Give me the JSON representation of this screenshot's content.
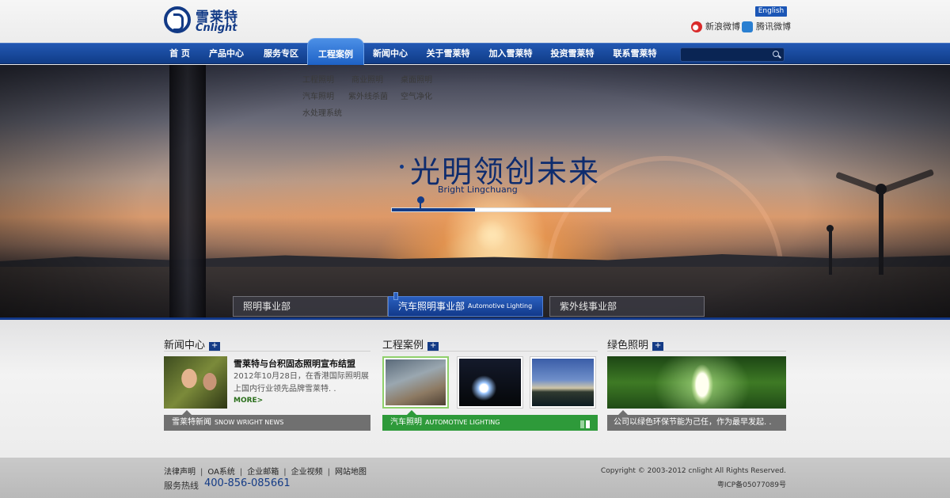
{
  "header": {
    "logo_cn": "雪莱特",
    "logo_en": "Cnlight",
    "language_button": "English",
    "weibo_sina": "新浪微博",
    "weibo_tencent": "腾讯微博"
  },
  "nav": {
    "items": [
      "首 页",
      "产品中心",
      "服务专区",
      "工程案例",
      "新闻中心",
      "关于雪莱特",
      "加入雪莱特",
      "投资雪莱特",
      "联系雪莱特"
    ],
    "active_index": 3,
    "search_placeholder": ""
  },
  "submenu": {
    "items": [
      "工程照明",
      "商业照明",
      "桌面照明",
      "汽车照明",
      "紫外线杀菌",
      "空气净化",
      "水处理系统"
    ]
  },
  "hero": {
    "slogan": "光明领创未来",
    "slogan_en": "Bright Lingchuang",
    "progress_fraction": 0.38,
    "tabs": [
      {
        "label": "照明事业部",
        "sub": ""
      },
      {
        "label": "汽车照明事业部",
        "sub": "Automotive Lighting"
      },
      {
        "label": "紫外线事业部",
        "sub": ""
      }
    ],
    "active_tab": 1
  },
  "news": {
    "title": "新闻中心",
    "headline": "雪莱特与台积固态照明宣布结盟",
    "desc": "2012年10月28日，在香港国际照明展上国内行业领先品牌雪莱特. .",
    "more": "MORE>",
    "bar_label": "雪莱特新闻",
    "bar_sub": "SNOW WRIGHT NEWS"
  },
  "cases": {
    "title": "工程案例",
    "bar_label": "汽车照明",
    "bar_sub": "AUTOMOTIVE LIGHTING"
  },
  "green": {
    "title": "绿色照明",
    "bar_label": "公司以绿色环保节能为己任，作为最早发起. ."
  },
  "footer": {
    "links": [
      "法律声明",
      "OA系统",
      "企业邮箱",
      "企业视频",
      "网站地图"
    ],
    "hotline_label": "服务热线",
    "hotline": "400-856-085661",
    "copyright": "Copyright © 2003-2012 cnlight All Rights Reserved.",
    "icp": "粤ICP备05077089号"
  },
  "colors": {
    "brand_blue": "#143b86",
    "nav_blue": "#1a4ea6",
    "case_green": "#2e9a3a",
    "bar_gray": "#707070"
  }
}
